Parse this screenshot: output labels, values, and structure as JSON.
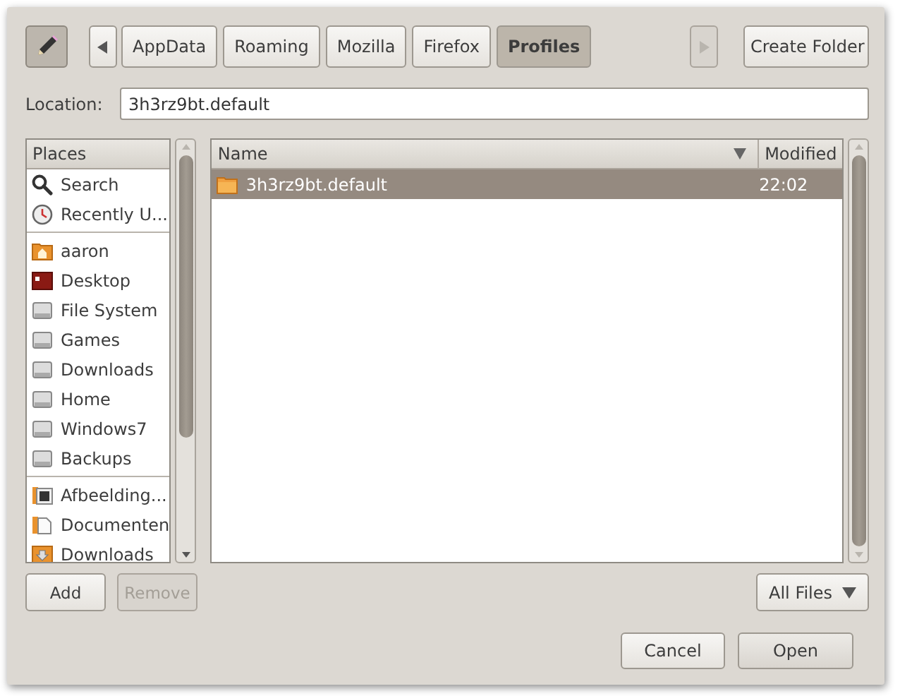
{
  "toolbar": {
    "edit_toggle": {
      "pressed": true
    },
    "back_arrow": {
      "disabled": false
    },
    "forward_arrow": {
      "disabled": true
    },
    "path": [
      {
        "label": "AppData",
        "selected": false
      },
      {
        "label": "Roaming",
        "selected": false
      },
      {
        "label": "Mozilla",
        "selected": false
      },
      {
        "label": "Firefox",
        "selected": false
      },
      {
        "label": "Profiles",
        "selected": true
      }
    ],
    "create_folder": "Create Folder"
  },
  "location": {
    "label": "Location:",
    "value": "3h3rz9bt.default"
  },
  "places": {
    "title": "Places",
    "groups": [
      {
        "items": [
          {
            "label": "Search",
            "kind": "search"
          },
          {
            "label": "Recently U...",
            "kind": "recent"
          }
        ]
      },
      {
        "items": [
          {
            "label": "aaron",
            "kind": "home"
          },
          {
            "label": "Desktop",
            "kind": "desktop"
          },
          {
            "label": "File System",
            "kind": "drive"
          },
          {
            "label": "Games",
            "kind": "drive"
          },
          {
            "label": "Downloads",
            "kind": "drive"
          },
          {
            "label": "Home",
            "kind": "drive"
          },
          {
            "label": "Windows7",
            "kind": "drive"
          },
          {
            "label": "Backups",
            "kind": "drive"
          }
        ]
      },
      {
        "items": [
          {
            "label": "Afbeelding...",
            "kind": "pictures"
          },
          {
            "label": "Documenten",
            "kind": "documents"
          },
          {
            "label": "Downloads",
            "kind": "downloads"
          }
        ]
      }
    ]
  },
  "files": {
    "columns": [
      "Name",
      "Modified"
    ],
    "rows": [
      {
        "name": "3h3rz9bt.default",
        "modified": "22:02",
        "kind": "folder",
        "selected": true
      }
    ]
  },
  "places_buttons": [
    {
      "label": "Add",
      "disabled": false
    },
    {
      "label": "Remove",
      "disabled": true
    }
  ],
  "filter": {
    "value": "All Files"
  },
  "buttons": [
    {
      "label": "Cancel",
      "default": false
    },
    {
      "label": "Open",
      "default": true
    }
  ]
}
